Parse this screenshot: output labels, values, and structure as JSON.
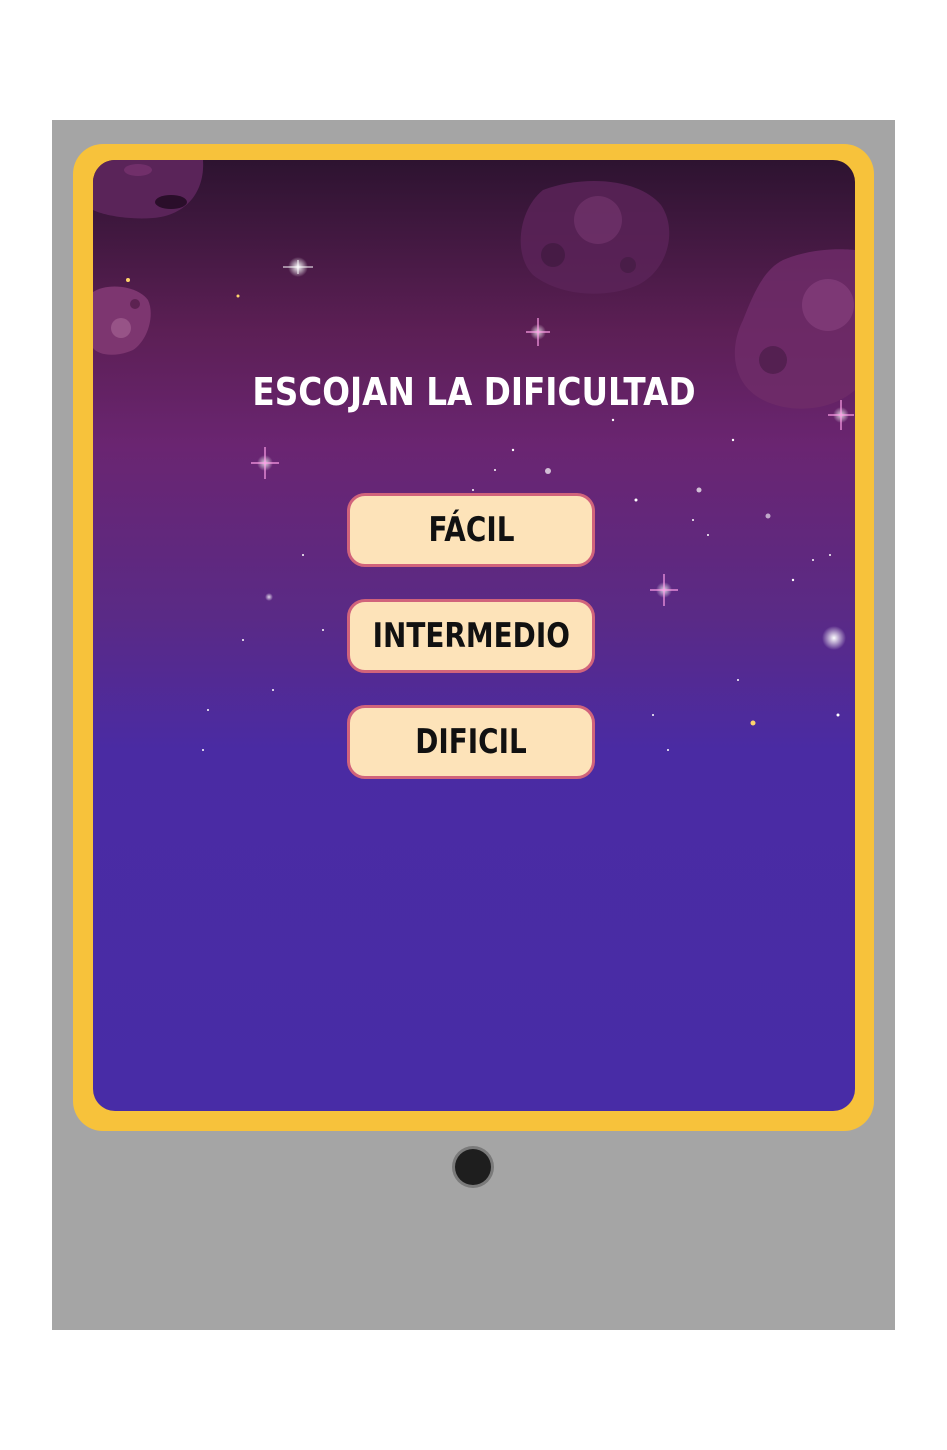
{
  "game": {
    "title": "ESCOJAN LA DIFICULTAD",
    "difficulty_options": [
      {
        "label": "FÁCIL"
      },
      {
        "label": "INTERMEDIO"
      },
      {
        "label": "DIFICIL"
      }
    ]
  },
  "colors": {
    "tablet_frame": "#a5a5a5",
    "bezel": "#f7c23b",
    "screen_top": "#2d1330",
    "screen_bottom": "#482ca6",
    "button_fill": "#fde3b9",
    "button_border": "#d1637b"
  },
  "icons": [
    "asteroid-icon",
    "star-icon",
    "home-button-icon"
  ]
}
